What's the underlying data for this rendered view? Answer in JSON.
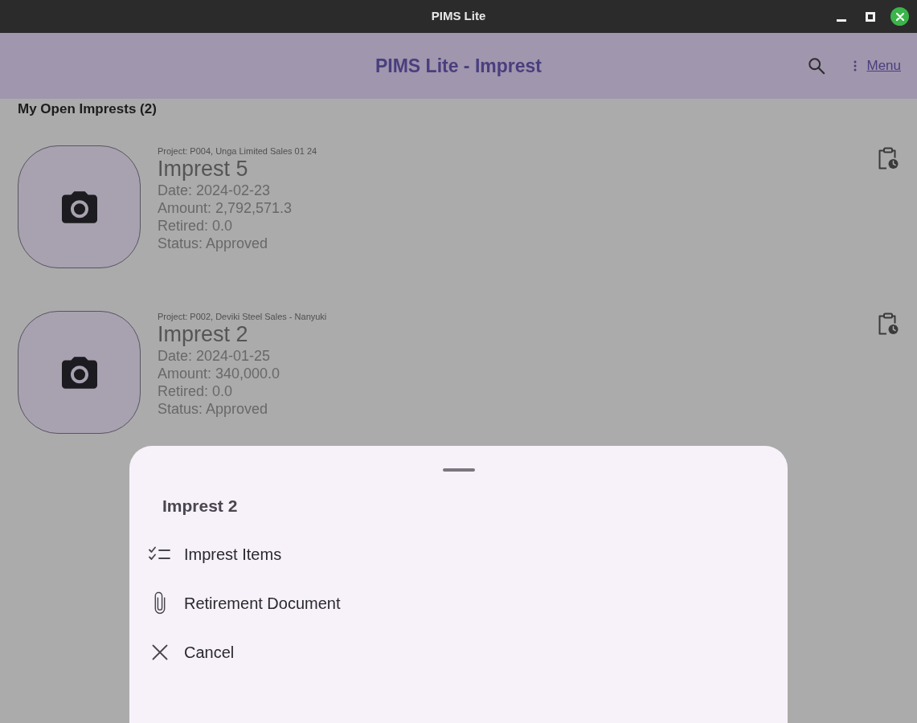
{
  "window": {
    "title": "PIMS Lite"
  },
  "app_bar": {
    "title": "PIMS Lite - Imprest",
    "menu_label": "Menu"
  },
  "section_title": "My Open Imprests (2)",
  "imprests": [
    {
      "project": "Project: P004, Unga Limited Sales 01 24",
      "title": "Imprest 5",
      "date": "Date: 2024-02-23",
      "amount": "Amount: 2,792,571.3",
      "retired": "Retired: 0.0",
      "status": "Status: Approved"
    },
    {
      "project": "Project: P002, Deviki Steel Sales - Nanyuki",
      "title": "Imprest 2",
      "date": "Date: 2024-01-25",
      "amount": "Amount: 340,000.0",
      "retired": "Retired: 0.0",
      "status": "Status: Approved"
    }
  ],
  "bottom_sheet": {
    "title": "Imprest 2",
    "actions": [
      {
        "label": "Imprest Items"
      },
      {
        "label": "Retirement Document"
      },
      {
        "label": "Cancel"
      }
    ]
  }
}
